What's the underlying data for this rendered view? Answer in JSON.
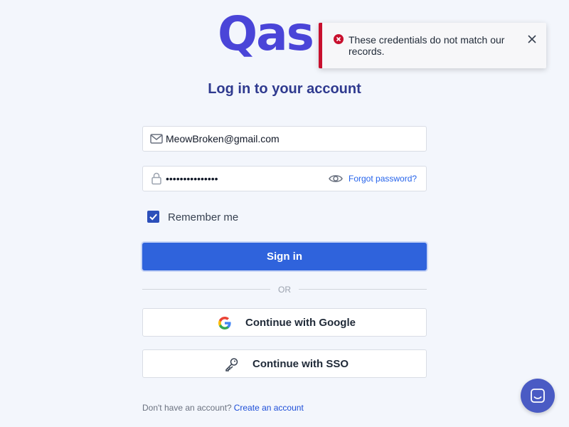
{
  "logo": {
    "text": "Qas"
  },
  "page": {
    "title": "Log in to your account"
  },
  "form": {
    "email_value": "MeowBroken@gmail.com",
    "password_value": "•••••••••••••••",
    "forgot_label": "Forgot password?",
    "remember_label": "Remember me",
    "remember_checked": true,
    "signin_label": "Sign in"
  },
  "divider": {
    "text": "OR"
  },
  "alt_login": {
    "google_label": "Continue with Google",
    "sso_label": "Continue with SSO"
  },
  "signup": {
    "prompt": "Don't have an account?",
    "link": "Create an account"
  },
  "toast": {
    "message": "These credentials do not match our records.",
    "type": "error"
  },
  "icons": {
    "email": "envelope-icon",
    "password": "lock-icon",
    "show_password": "eye-icon",
    "checkbox": "checkmark-icon",
    "google": "google-icon",
    "sso": "key-icon",
    "toast_error": "error-circle-icon",
    "toast_close": "close-icon",
    "chat": "chat-icon"
  },
  "colors": {
    "brand": "#4a45d8",
    "title": "#2f3a8f",
    "primary_button": "#2f63dc",
    "link": "#2563eb",
    "error": "#c8102e",
    "background": "#f3f6fc",
    "chat_button": "#4a5bc4"
  }
}
